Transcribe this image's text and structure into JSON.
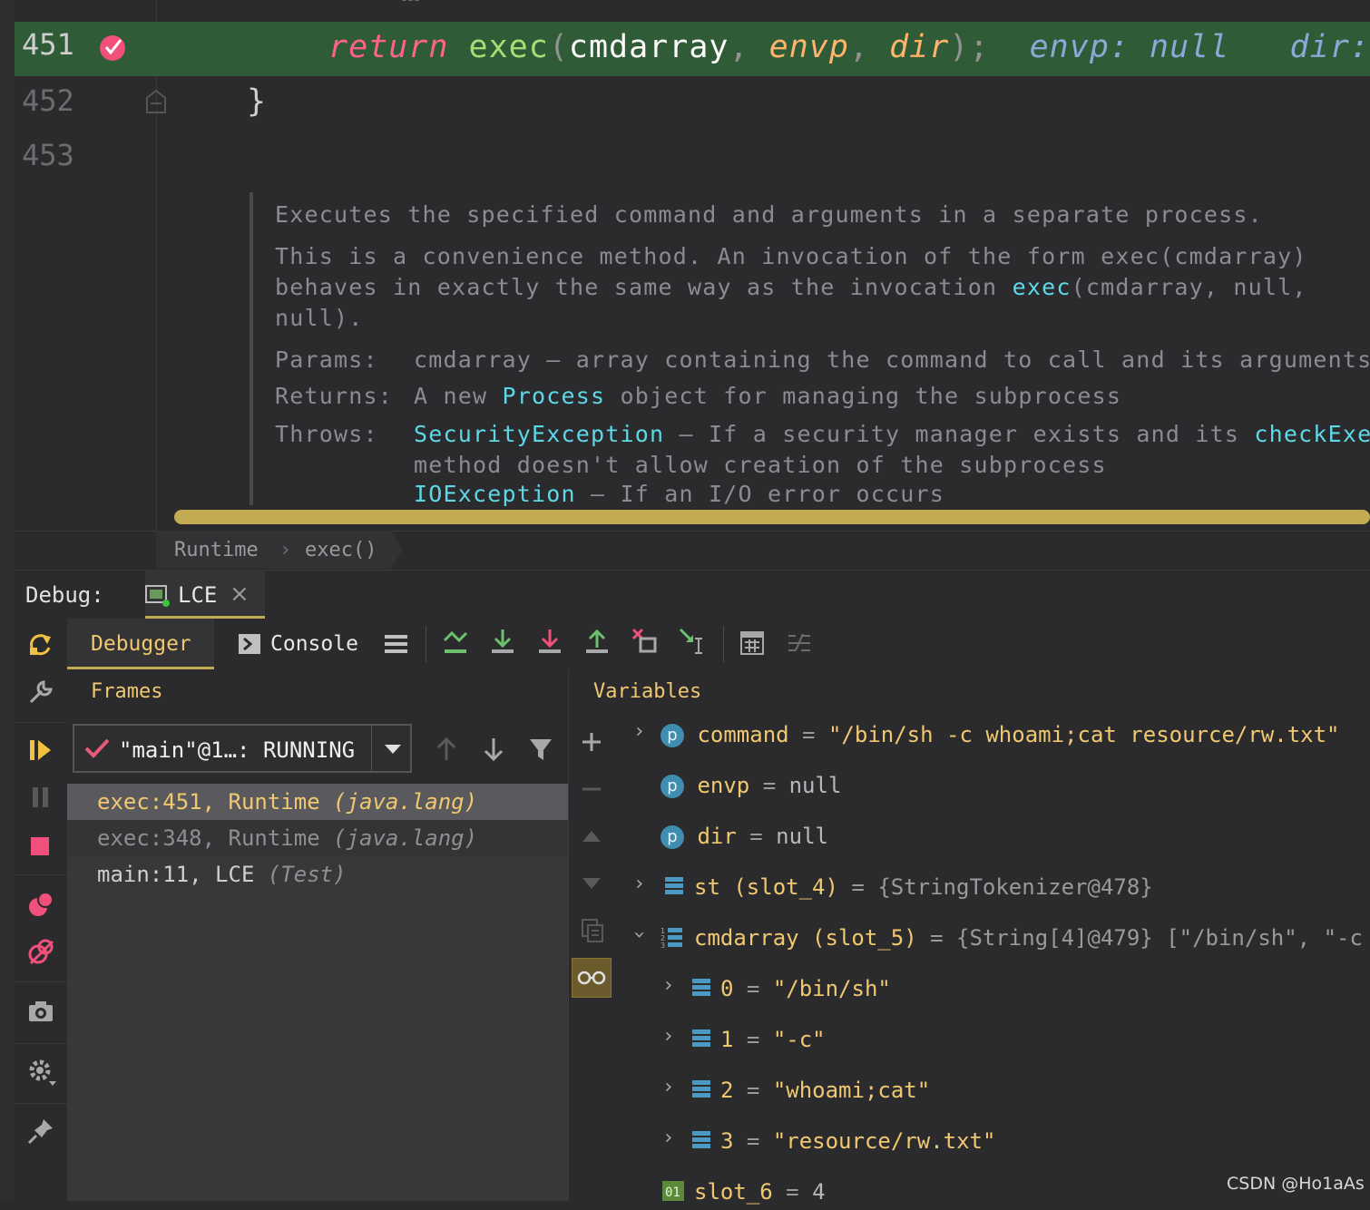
{
  "editor": {
    "lines": [
      {
        "number": "451"
      },
      {
        "number": "452"
      },
      {
        "number": "453"
      }
    ],
    "code_451": {
      "kw": "return",
      "fn": "exec",
      "open": "(",
      "arg1": "cmdarray",
      "comma1": ",",
      "arg2": "envp",
      "comma2": ",",
      "arg3": "dir",
      "close": ");",
      "hint1": "envp: null",
      "hint2": "dir:"
    },
    "code_452": "}",
    "doc": {
      "line1": "Executes the specified command and arguments in a separate process.",
      "line2": "This is a convenience method. An invocation of the form exec(cmdarray)",
      "line3_a": "behaves in exactly the same way as the invocation ",
      "line3_link": "exec",
      "line3_b": "(cmdarray, null,",
      "line4": "null).",
      "params_label": "Params:",
      "params_text": "cmdarray — array containing the command to call and its arguments.",
      "returns_label": "Returns:",
      "returns_a": "A new ",
      "returns_link": "Process",
      "returns_b": " object for managing the subprocess",
      "throws_label": "Throws:",
      "throws_link1": "SecurityException",
      "throws_a": " — If a security manager exists and its ",
      "throws_link2": "checkExec",
      "throws_b": "method doesn't allow creation of the subprocess",
      "throws_link3": "IOException",
      "throws_c": " — If an I/O error occurs"
    },
    "breadcrumb": [
      "Runtime",
      "exec()"
    ]
  },
  "debug": {
    "label": "Debug:",
    "tab": "LCE",
    "subtabs": {
      "debugger": "Debugger",
      "console": "Console"
    },
    "frames_title": "Frames",
    "variables_title": "Variables",
    "thread": "\"main\"@1…: RUNNING",
    "frames": [
      {
        "text": "exec:451, Runtime ",
        "pkg": "(java.lang)"
      },
      {
        "text": "exec:348, Runtime ",
        "pkg": "(java.lang)"
      },
      {
        "text": "main:11, LCE ",
        "pkg": "(Test)"
      }
    ],
    "variables": {
      "command": {
        "name": "command",
        "eq": " = ",
        "value": "\"/bin/sh -c whoami;cat resource/rw.txt\""
      },
      "envp": {
        "name": "envp",
        "eq": " = ",
        "value": "null"
      },
      "dir": {
        "name": "dir",
        "eq": " = ",
        "value": "null"
      },
      "st": {
        "name": "st (slot_4)",
        "eq": " = ",
        "value": "{StringTokenizer@478}"
      },
      "cmdarray": {
        "name": "cmdarray (slot_5)",
        "eq": " = ",
        "value": "{String[4]@479} [\"/bin/sh\", \"-c"
      },
      "items": [
        {
          "name": "0",
          "eq": " = ",
          "value": "\"/bin/sh\""
        },
        {
          "name": "1",
          "eq": " = ",
          "value": "\"-c\""
        },
        {
          "name": "2",
          "eq": " = ",
          "value": "\"whoami;cat\""
        },
        {
          "name": "3",
          "eq": " = ",
          "value": "\"resource/rw.txt\""
        }
      ],
      "slot6": {
        "name": "slot_6",
        "eq": " = ",
        "value": "4"
      }
    }
  },
  "watermark": "CSDN @Ho1aAs",
  "colors": {
    "exec_line": "#2f5b37",
    "accent": "#c2ab52"
  }
}
